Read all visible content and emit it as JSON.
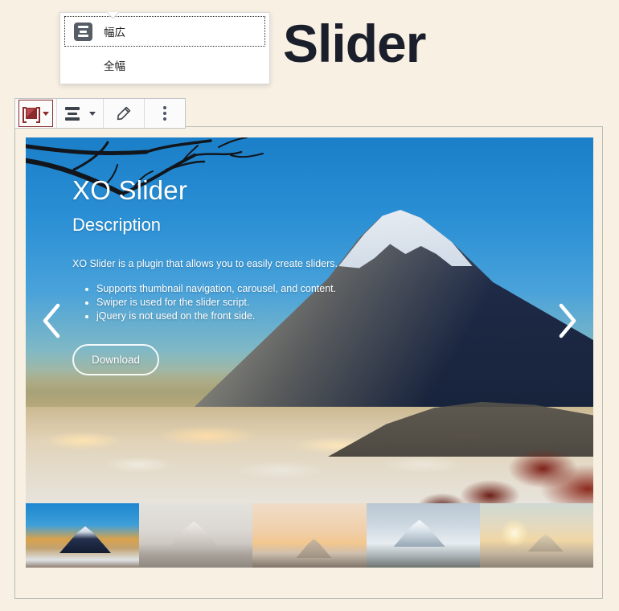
{
  "page": {
    "background_color": "#f7f0e3",
    "post_title": "Slider"
  },
  "width_popover": {
    "items": [
      {
        "label": "幅広",
        "icon": "wide-width-icon",
        "selected": true
      },
      {
        "label": "全幅",
        "icon": "full-width-icon",
        "selected": false
      }
    ]
  },
  "block_toolbar": {
    "buttons": [
      {
        "name": "block-type-image",
        "icon": "image-block-icon",
        "caret": "chevron-down-icon",
        "selected": true
      },
      {
        "name": "change-alignment",
        "icon": "wide-width-icon",
        "caret": "chevron-down-icon",
        "selected": false
      },
      {
        "name": "edit",
        "icon": "pencil-icon",
        "selected": false
      },
      {
        "name": "more-options",
        "icon": "vertical-ellipsis-icon",
        "selected": false
      }
    ]
  },
  "slider": {
    "prev_label": "Previous slide",
    "next_label": "Next slide",
    "slide": {
      "heading": "XO Slider",
      "subheading": "Description",
      "paragraph": "XO Slider is a plugin that allows you to easily create sliders.",
      "bullets": [
        "Supports thumbnail navigation, carousel, and content.",
        "Swiper is used for the slider script.",
        "jQuery is not used on the front side."
      ],
      "button_label": "Download"
    },
    "thumbnails": [
      {
        "name": "thumbnail-1",
        "active": true
      },
      {
        "name": "thumbnail-2",
        "active": false
      },
      {
        "name": "thumbnail-3",
        "active": false
      },
      {
        "name": "thumbnail-4",
        "active": false
      },
      {
        "name": "thumbnail-5",
        "active": false
      }
    ]
  },
  "colors": {
    "accent_red": "#8b2b2b",
    "toolbar_border": "#c3c4c7",
    "frame_border": "#b9beb4",
    "icon_dark": "#555d66",
    "sky_blue": "#2a8fd4"
  }
}
